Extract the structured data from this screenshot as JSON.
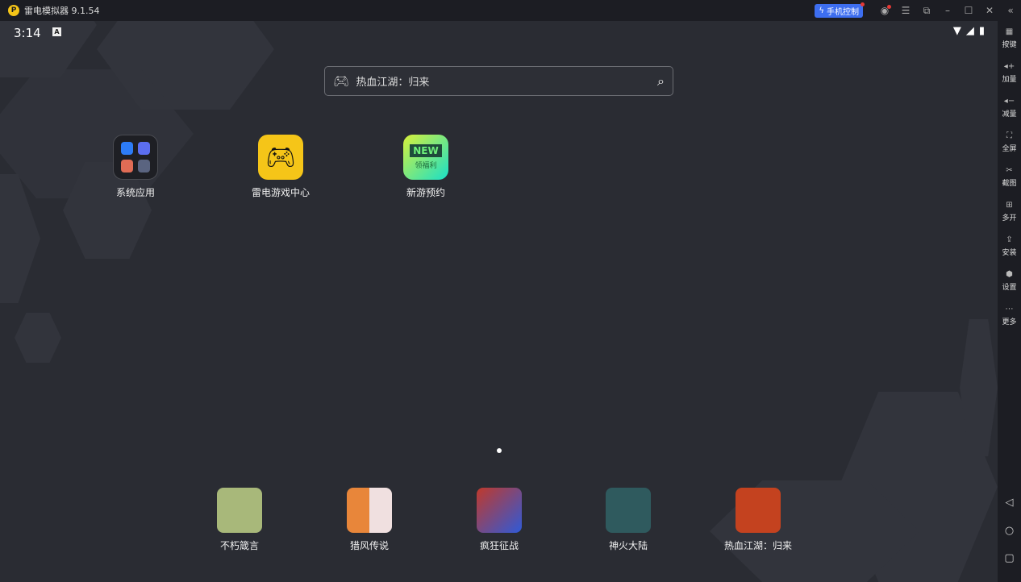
{
  "titlebar": {
    "title": "雷电模拟器 9.1.54",
    "phone_control": "手机控制"
  },
  "status": {
    "time": "3:14",
    "badge": "A"
  },
  "search": {
    "text": "热血江湖：归来"
  },
  "apps": [
    {
      "label": "系统应用"
    },
    {
      "label": "雷电游戏中心"
    },
    {
      "label": "新游预约",
      "badge_top": "NEW",
      "badge_bottom": "领福利"
    }
  ],
  "dock": [
    {
      "label": "不朽箴言",
      "color": "#a8b87a"
    },
    {
      "label": "猎风传说",
      "color": "#e8863a"
    },
    {
      "label": "疯狂征战",
      "color": "#c0392b"
    },
    {
      "label": "神火大陆",
      "color": "#2f5a5e"
    },
    {
      "label": "热血江湖：归来",
      "color": "#c4421f"
    }
  ],
  "sidebar": [
    {
      "label": "按键",
      "icon": "▦"
    },
    {
      "label": "加量",
      "icon": "◂+"
    },
    {
      "label": "减量",
      "icon": "◂−"
    },
    {
      "label": "全屏",
      "icon": "⛶"
    },
    {
      "label": "截图",
      "icon": "✂"
    },
    {
      "label": "多开",
      "icon": "⊞"
    },
    {
      "label": "安装",
      "icon": "⇪"
    },
    {
      "label": "设置",
      "icon": "⬢"
    },
    {
      "label": "更多",
      "icon": "⋯"
    }
  ],
  "colors": {
    "accent": "#3d6ef0",
    "logo": "#f5c518"
  }
}
